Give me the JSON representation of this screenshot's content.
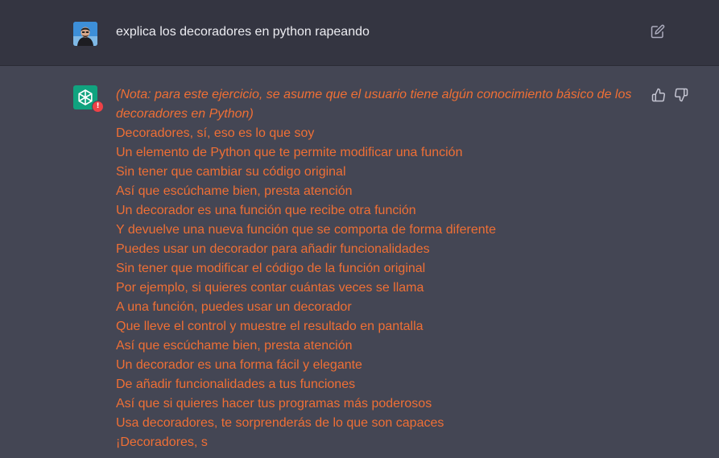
{
  "user_message": {
    "text": "explica los decoradores en python rapeando",
    "avatar_icon": "user-avatar-icon",
    "edit_icon": "edit-icon"
  },
  "assistant_message": {
    "avatar_icon": "openai-logo-icon",
    "warning_icon": "warning-icon",
    "warning_glyph": "!",
    "note": "(Nota: para este ejercicio, se asume que el usuario tiene algún conocimiento básico de los decoradores en Python)",
    "lines": [
      "Decoradores, sí, eso es lo que soy",
      "Un elemento de Python que te permite modificar una función",
      "Sin tener que cambiar su código original",
      "Así que escúchame bien, presta atención",
      "Un decorador es una función que recibe otra función",
      "Y devuelve una nueva función que se comporta de forma diferente",
      "Puedes usar un decorador para añadir funcionalidades",
      "Sin tener que modificar el código de la función original",
      "Por ejemplo, si quieres contar cuántas veces se llama",
      "A una función, puedes usar un decorador",
      "Que lleve el control y muestre el resultado en pantalla",
      "Así que escúchame bien, presta atención",
      "Un decorador es una forma fácil y elegante",
      "De añadir funcionalidades a tus funciones",
      "Así que si quieres hacer tus programas más poderosos",
      "Usa decoradores, te sorprenderás de lo que son capaces",
      "¡Decoradores, s"
    ],
    "feedback_icons": [
      "thumbs-up-icon",
      "thumbs-down-icon"
    ]
  },
  "colors": {
    "user_bg": "#343541",
    "assistant_bg": "#444654",
    "answer_text": "#ef6f35",
    "user_text": "#ececf1",
    "gpt_green": "#10a37f",
    "warning_red": "#ef4146"
  }
}
